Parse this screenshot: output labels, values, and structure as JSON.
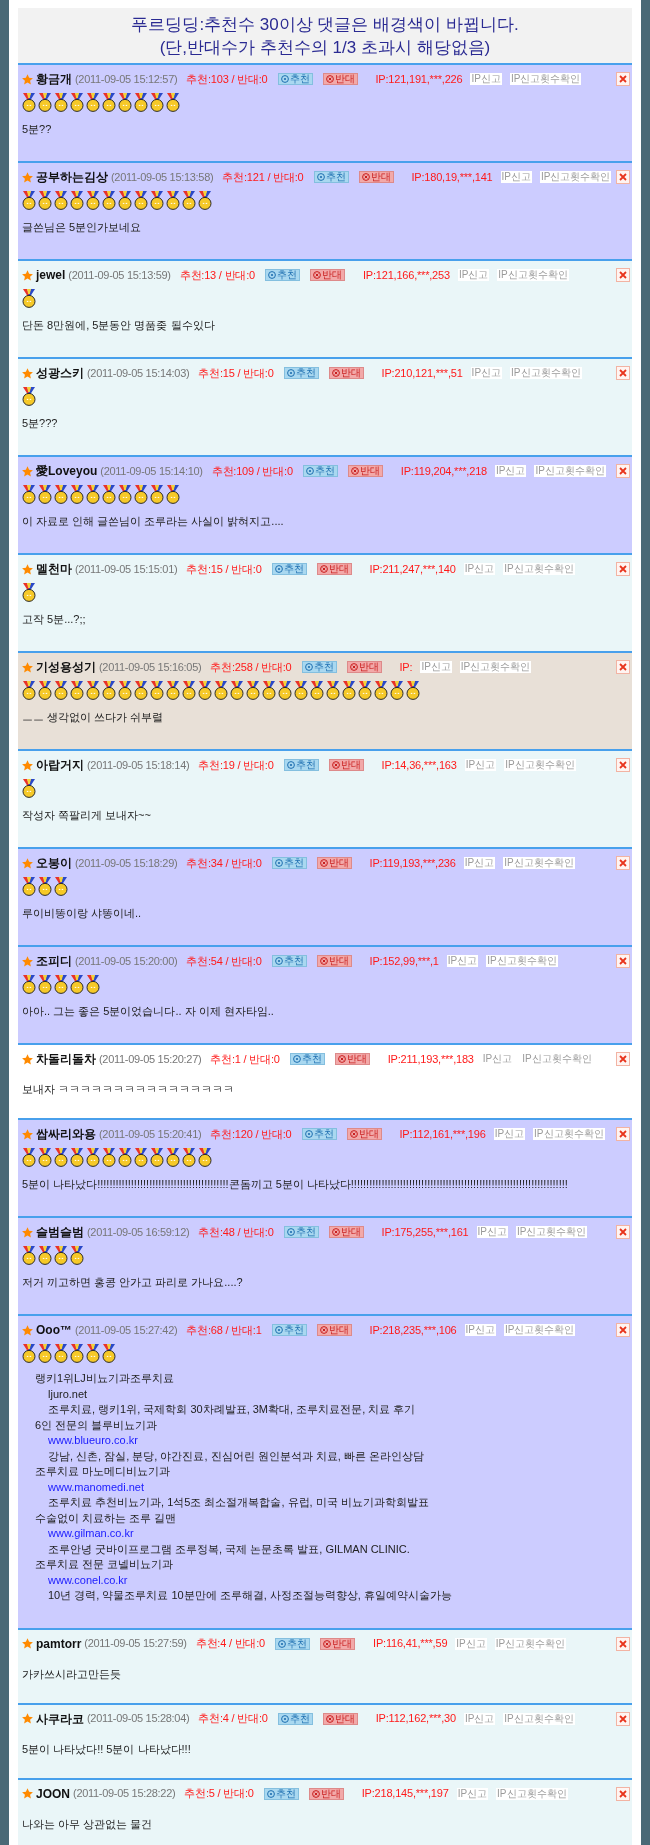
{
  "notice": {
    "lines": [
      "푸르딩딩:추천수 30이상 댓글은 배경색이 바뀝니다.",
      "(단,반대수가 추천수의 1/3 초과시 해당없음)"
    ]
  },
  "comments": [
    {
      "author": "황금개",
      "date": "(2011-09-05 15:12:57)",
      "votes": "추천:103 / 반대:0",
      "upvote": "추천",
      "downvote": "반대",
      "ip": "IP:121,191,***,226",
      "report": "IP신고",
      "report_count": "IP신고횟수확인",
      "color": "#ccccff",
      "medals": [
        {
          "kind": "medal"
        },
        {
          "kind": "medal"
        },
        {
          "kind": "medal"
        },
        {
          "kind": "medal"
        },
        {
          "kind": "medal"
        },
        {
          "kind": "medal"
        },
        {
          "kind": "medal"
        },
        {
          "kind": "medal"
        },
        {
          "kind": "medal"
        },
        {
          "kind": "medal"
        }
      ],
      "kind": "text",
      "text": "5분??"
    },
    {
      "author": "공부하는김상",
      "date": "(2011-09-05 15:13:58)",
      "votes": "추천:121 / 반대:0",
      "upvote": "추천",
      "downvote": "반대",
      "ip": "IP:180,19,***,141",
      "report": "IP신고",
      "report_count": "IP신고횟수확인",
      "color": "#ccccff",
      "medals": [
        {
          "kind": "medal"
        },
        {
          "kind": "medal"
        },
        {
          "kind": "medal"
        },
        {
          "kind": "medal"
        },
        {
          "kind": "medal"
        },
        {
          "kind": "medal"
        },
        {
          "kind": "medal"
        },
        {
          "kind": "medal"
        },
        {
          "kind": "medal"
        },
        {
          "kind": "medal"
        },
        {
          "kind": "medal"
        },
        {
          "kind": "medal"
        }
      ],
      "kind": "text",
      "text": "글쓴님은 5분인가보네요"
    },
    {
      "author": "jewel",
      "date": "(2011-09-05 15:13:59)",
      "votes": "추천:13 / 반대:0",
      "upvote": "추천",
      "downvote": "반대",
      "ip": "IP:121,166,***,253",
      "report": "IP신고",
      "report_count": "IP신고횟수확인",
      "color": "#eaf6f8",
      "medals": [
        {
          "kind": "medal"
        }
      ],
      "kind": "text",
      "text": "단돈 8만원에, 5분동안 명품좆 될수있다"
    },
    {
      "author": "성광스키",
      "date": "(2011-09-05 15:14:03)",
      "votes": "추천:15 / 반대:0",
      "upvote": "추천",
      "downvote": "반대",
      "ip": "IP:210,121,***,51",
      "report": "IP신고",
      "report_count": "IP신고횟수확인",
      "color": "#eaf6f8",
      "medals": [
        {
          "kind": "medal"
        }
      ],
      "kind": "text",
      "text": "5분???"
    },
    {
      "author": "愛Loveyou",
      "date": "(2011-09-05 15:14:10)",
      "votes": "추천:109 / 반대:0",
      "upvote": "추천",
      "downvote": "반대",
      "ip": "IP:119,204,***,218",
      "report": "IP신고",
      "report_count": "IP신고횟수확인",
      "color": "#ccccff",
      "medals": [
        {
          "kind": "medal"
        },
        {
          "kind": "medal"
        },
        {
          "kind": "medal"
        },
        {
          "kind": "medal"
        },
        {
          "kind": "medal"
        },
        {
          "kind": "medal"
        },
        {
          "kind": "medal"
        },
        {
          "kind": "medal"
        },
        {
          "kind": "medal"
        },
        {
          "kind": "medal"
        }
      ],
      "kind": "text",
      "text": "이 자료로 인해 글쓴님이 조루라는 사실이 밝혀지고...."
    },
    {
      "author": "멜천마",
      "date": "(2011-09-05 15:15:01)",
      "votes": "추천:15 / 반대:0",
      "upvote": "추천",
      "downvote": "반대",
      "ip": "IP:211,247,***,140",
      "report": "IP신고",
      "report_count": "IP신고횟수확인",
      "color": "#eaf6f8",
      "medals": [
        {
          "kind": "medal"
        }
      ],
      "kind": "text",
      "text": "고작 5분...?;;"
    },
    {
      "author": "기성용성기",
      "date": "(2011-09-05 15:16:05)",
      "votes": "추천:258 / 반대:0",
      "upvote": "추천",
      "downvote": "반대",
      "ip": "IP:",
      "report": "IP신고",
      "report_count": "IP신고횟수확인",
      "color": "#e8e0d7",
      "medals": [
        {
          "kind": "medal"
        },
        {
          "kind": "medal"
        },
        {
          "kind": "medal"
        },
        {
          "kind": "medal"
        },
        {
          "kind": "medal"
        },
        {
          "kind": "medal"
        },
        {
          "kind": "medal"
        },
        {
          "kind": "medal"
        },
        {
          "kind": "medal"
        },
        {
          "kind": "medal"
        },
        {
          "kind": "medal"
        },
        {
          "kind": "medal"
        },
        {
          "kind": "medal"
        },
        {
          "kind": "medal"
        },
        {
          "kind": "medal"
        },
        {
          "kind": "medal"
        },
        {
          "kind": "medal"
        },
        {
          "kind": "medal"
        },
        {
          "kind": "medal"
        },
        {
          "kind": "medal"
        },
        {
          "kind": "medal"
        },
        {
          "kind": "medal"
        },
        {
          "kind": "medal"
        },
        {
          "kind": "medal"
        },
        {
          "kind": "medal"
        }
      ],
      "kind": "text",
      "text": "ㅡㅡ 생각없이 쓰다가 쉬부렬"
    },
    {
      "author": "아랍거지",
      "date": "(2011-09-05 15:18:14)",
      "votes": "추천:19 / 반대:0",
      "upvote": "추천",
      "downvote": "반대",
      "ip": "IP:14,36,***,163",
      "report": "IP신고",
      "report_count": "IP신고횟수확인",
      "color": "#eaf6f8",
      "medals": [
        {
          "kind": "medal"
        }
      ],
      "kind": "text",
      "text": "작성자 쪽팔리게 보내자~~"
    },
    {
      "author": "오봉이",
      "date": "(2011-09-05 15:18:29)",
      "votes": "추천:34 / 반대:0",
      "upvote": "추천",
      "downvote": "반대",
      "ip": "IP:119,193,***,236",
      "report": "IP신고",
      "report_count": "IP신고횟수확인",
      "color": "#ccccff",
      "medals": [
        {
          "kind": "medal"
        },
        {
          "kind": "medal"
        },
        {
          "kind": "medal"
        }
      ],
      "kind": "text",
      "text": "루이비똥이랑 샤똥이네.."
    },
    {
      "author": "조피디",
      "date": "(2011-09-05 15:20:00)",
      "votes": "추천:54 / 반대:0",
      "upvote": "추천",
      "downvote": "반대",
      "ip": "IP:152,99,***,1",
      "report": "IP신고",
      "report_count": "IP신고횟수확인",
      "color": "#ccccff",
      "medals": [
        {
          "kind": "medal"
        },
        {
          "kind": "medal"
        },
        {
          "kind": "medal"
        },
        {
          "kind": "medal"
        },
        {
          "kind": "medal"
        }
      ],
      "kind": "text",
      "text": "아아.. 그는 좋은 5분이었습니다.. 자 이제 현자타임.."
    },
    {
      "author": "차돌리돌차",
      "date": "(2011-09-05 15:20:27)",
      "votes": "추천:1 / 반대:0",
      "upvote": "추천",
      "downvote": "반대",
      "ip": "IP:211,193,***,183",
      "report": "IP신고",
      "report_count": "IP신고횟수확인",
      "color": "#ffffff",
      "kind": "text",
      "text": "보내자 ㅋㅋㅋㅋㅋㅋㅋㅋㅋㅋㅋㅋㅋㅋㅋㅋ"
    },
    {
      "author": "쌉싸리와용",
      "date": "(2011-09-05 15:20:41)",
      "votes": "추천:120 / 반대:0",
      "upvote": "추천",
      "downvote": "반대",
      "ip": "IP:112,161,***,196",
      "report": "IP신고",
      "report_count": "IP신고횟수확인",
      "color": "#ccccff",
      "medals": [
        {
          "kind": "medal"
        },
        {
          "kind": "medal"
        },
        {
          "kind": "medal"
        },
        {
          "kind": "medal"
        },
        {
          "kind": "medal"
        },
        {
          "kind": "medal"
        },
        {
          "kind": "medal"
        },
        {
          "kind": "medal"
        },
        {
          "kind": "medal"
        },
        {
          "kind": "medal"
        },
        {
          "kind": "medal"
        },
        {
          "kind": "medal"
        }
      ],
      "kind": "text",
      "text": "5분이 나타났다!!!!!!!!!!!!!!!!!!!!!!!!!!!!!!!!!!!!!!!!!!!콘돔끼고 5분이 나타났다!!!!!!!!!!!!!!!!!!!!!!!!!!!!!!!!!!!!!!!!!!!!!!!!!!!!!!!!!!!!!!!!!!!!!!!"
    },
    {
      "author": "슬범슬범",
      "date": "(2011-09-05 16:59:12)",
      "votes": "추천:48 / 반대:0",
      "upvote": "추천",
      "downvote": "반대",
      "ip": "IP:175,255,***,161",
      "report": "IP신고",
      "report_count": "IP신고횟수확인",
      "color": "#ccccff",
      "medals": [
        {
          "kind": "medal"
        },
        {
          "kind": "medal"
        },
        {
          "kind": "medal"
        },
        {
          "kind": "medal"
        }
      ],
      "kind": "text",
      "text": "저거 끼고하면 홍콩 안가고 파리로 가나요....?"
    },
    {
      "author": "Ooo™",
      "date": "(2011-09-05 15:27:42)",
      "votes": "추천:68 / 반대:1",
      "upvote": "추천",
      "downvote": "반대",
      "ip": "IP:218,235,***,106",
      "report": "IP신고",
      "report_count": "IP신고횟수확인",
      "color": "#ccccff",
      "medals": [
        {
          "kind": "medal"
        },
        {
          "kind": "medal"
        },
        {
          "kind": "medal"
        },
        {
          "kind": "medal"
        },
        {
          "kind": "medal"
        },
        {
          "kind": "medal"
        }
      ],
      "kind": "ad",
      "ad": [
        {
          "title": "랭키1위LJ비뇨기과조루치료",
          "url": "ljuro.net",
          "link": false,
          "description": "조루치료, 랭키1위, 국제학회 30차례발표, 3M확대, 조루치료전문, 치료 후기"
        },
        {
          "title": "6인 전문의 블루비뇨기과",
          "url": "www.blueuro.co.kr",
          "link": true,
          "description": "강남, 신촌, 잠실, 분당, 야간진료, 진심어린 원인분석과 치료, 빠른 온라인상담"
        },
        {
          "title": "조루치료 마노메디비뇨기과",
          "url": "www.manomedi.net",
          "link": true,
          "description": "조루치료 추천비뇨기과, 1석5조 최소절개복합술, 유럽, 미국 비뇨기과학회발표"
        },
        {
          "title": "수술없이 치료하는 조루 길맨",
          "url": "www.gilman.co.kr",
          "link": true,
          "description": "조루안녕 굿바이프로그램 조루정복, 국제 논문초록 발표, GILMAN CLINIC."
        },
        {
          "title": "조루치료 전문 코넬비뇨기과",
          "url": "www.conel.co.kr",
          "link": true,
          "description": "10년 경력, 약물조루치료 10분만에 조루해결, 사정조절능력향상, 휴일예약시술가능"
        }
      ]
    },
    {
      "author": "pamtorr",
      "date": "(2011-09-05 15:27:59)",
      "votes": "추천:4 / 반대:0",
      "upvote": "추천",
      "downvote": "반대",
      "ip": "IP:116,41,***,59",
      "report": "IP신고",
      "report_count": "IP신고횟수확인",
      "color": "#eaf6f8",
      "kind": "text",
      "text": "가카쓰시라고만든듯"
    },
    {
      "author": "사쿠라코",
      "date": "(2011-09-05 15:28:04)",
      "votes": "추천:4 / 반대:0",
      "upvote": "추천",
      "downvote": "반대",
      "ip": "IP:112,162,***,30",
      "report": "IP신고",
      "report_count": "IP신고횟수확인",
      "color": "#eaf6f8",
      "kind": "text",
      "text": "5분이 나타났다!! 5분이 나타났다!!!"
    },
    {
      "author": "JOON",
      "date": "(2011-09-05 15:28:22)",
      "votes": "추천:5 / 반대:0",
      "upvote": "추천",
      "downvote": "반대",
      "ip": "IP:218,145,***,197",
      "report": "IP신고",
      "report_count": "IP신고횟수확인",
      "color": "#eaf6f8",
      "kind": "text",
      "text": "나와는 아무 상관없는 물건"
    }
  ]
}
